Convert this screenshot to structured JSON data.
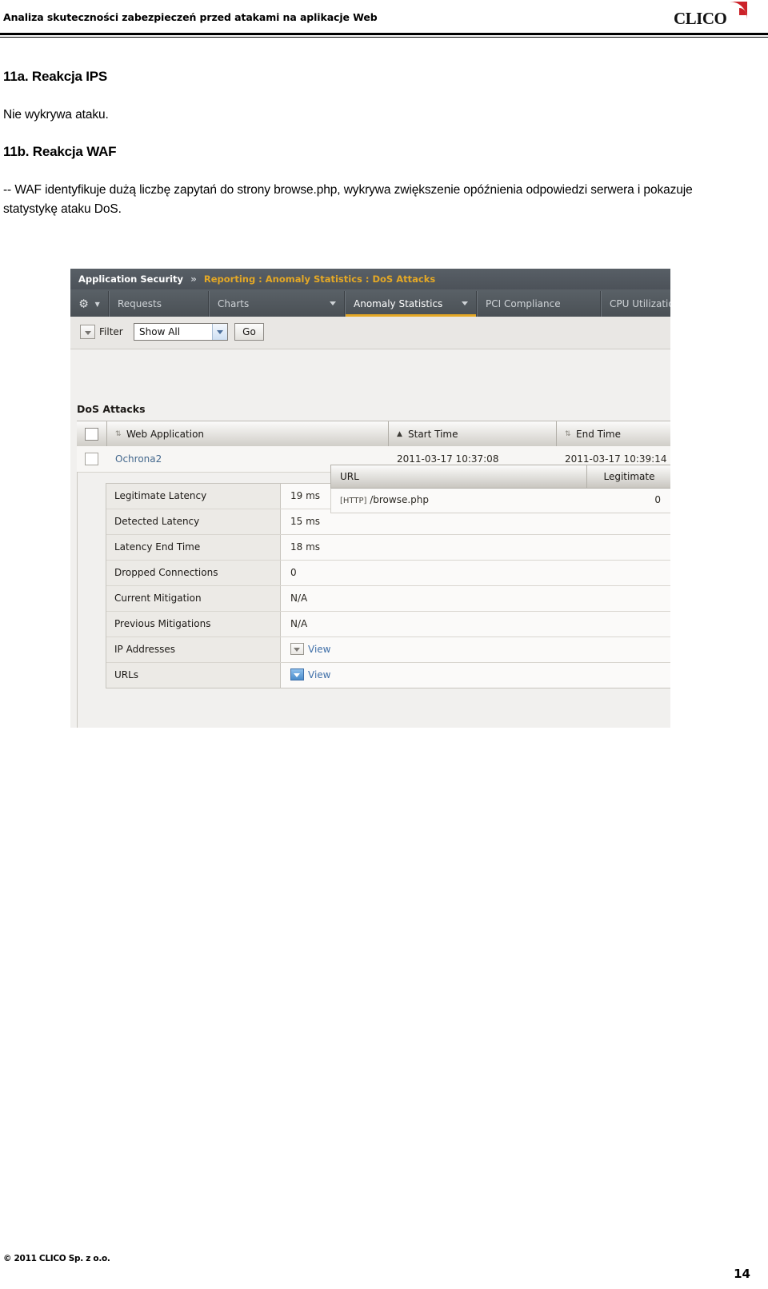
{
  "document": {
    "header_title": "Analiza skuteczności zabezpieczeń przed atakami na aplikacje Web",
    "logo_word": "CLICO",
    "logo_mark_color": "#cc2229",
    "footer_copyright": "© 2011 CLICO Sp. z o.o.",
    "page_number": "14"
  },
  "sections": [
    {
      "heading": "11a. Reakcja IPS",
      "paragraph": "Nie wykrywa ataku."
    },
    {
      "heading": "11b. Reakcja WAF",
      "paragraph": "-- WAF identyfikuje dużą liczbę zapytań do strony browse.php, wykrywa zwiększenie opóźnienia odpowiedzi serwera i pokazuje statystykę ataku DoS."
    }
  ],
  "screenshot": {
    "breadcrumb": {
      "root": "Application Security",
      "separator": "»",
      "path": "Reporting : Anomaly Statistics : DoS Attacks"
    },
    "tabs": [
      {
        "label": "",
        "name": "gear"
      },
      {
        "label": "Requests",
        "name": "requests"
      },
      {
        "label": "Charts",
        "name": "charts"
      },
      {
        "label": "Anomaly Statistics",
        "name": "anomaly-statistics"
      },
      {
        "label": "PCI Compliance",
        "name": "pci-compliance"
      },
      {
        "label": "CPU Utilization",
        "name": "cpu-utilization"
      }
    ],
    "filter": {
      "label": "Filter",
      "value": "Show All",
      "go_label": "Go"
    },
    "table": {
      "title": "DoS Attacks",
      "columns": [
        "Web Application",
        "Start Time",
        "End Time"
      ],
      "sort": {
        "column": "Start Time",
        "direction": "asc"
      },
      "rows": [
        {
          "web_application": "Ochrona2",
          "start_time": "2011-03-17 10:37:08",
          "end_time": "2011-03-17 10:39:14"
        }
      ]
    },
    "detail": [
      {
        "key": "Legitimate Latency",
        "value": "19 ms"
      },
      {
        "key": "Detected Latency",
        "value": "15 ms"
      },
      {
        "key": "Latency End Time",
        "value": "18 ms"
      },
      {
        "key": "Dropped Connections",
        "value": "0"
      },
      {
        "key": "Current Mitigation",
        "value": "N/A"
      },
      {
        "key": "Previous Mitigations",
        "value": "N/A"
      },
      {
        "key": "IP Addresses",
        "value": "View"
      },
      {
        "key": "URLs",
        "value": "View"
      }
    ],
    "url_table": {
      "columns": [
        "URL",
        "Legitimate"
      ],
      "rows": [
        {
          "protocol": "[HTTP]",
          "url": " /browse.php",
          "legitimate": "0"
        }
      ]
    }
  }
}
